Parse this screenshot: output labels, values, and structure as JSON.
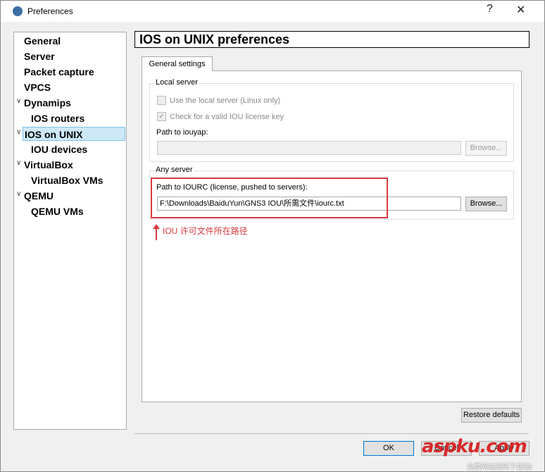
{
  "window": {
    "title": "Preferences",
    "help": "?",
    "close": "✕"
  },
  "sidebar": {
    "items": [
      {
        "label": "General",
        "level": 0
      },
      {
        "label": "Server",
        "level": 0
      },
      {
        "label": "Packet capture",
        "level": 0
      },
      {
        "label": "VPCS",
        "level": 0
      },
      {
        "label": "Dynamips",
        "level": 0,
        "expanded": true
      },
      {
        "label": "IOS routers",
        "level": 1
      },
      {
        "label": "IOS on UNIX",
        "level": 0,
        "expanded": true,
        "selected": true
      },
      {
        "label": "IOU devices",
        "level": 1
      },
      {
        "label": "VirtualBox",
        "level": 0,
        "expanded": true
      },
      {
        "label": "VirtualBox VMs",
        "level": 1
      },
      {
        "label": "QEMU",
        "level": 0,
        "expanded": true
      },
      {
        "label": "QEMU VMs",
        "level": 1
      }
    ]
  },
  "header": {
    "title": "IOS on UNIX preferences"
  },
  "tabs": [
    {
      "label": "General settings"
    }
  ],
  "local_server": {
    "title": "Local server",
    "use_local": "Use the local server (Linux only)",
    "use_local_checked": false,
    "check_license": "Check for a valid IOU license key",
    "check_license_checked": true,
    "iouyap_label": "Path to iouyap:",
    "iouyap_value": "",
    "browse": "Browse..."
  },
  "any_server": {
    "title": "Any server",
    "iourc_label": "Path to IOURC (license, pushed to servers):",
    "iourc_value": "F:\\Downloads\\BaiduYun\\GNS3 IOU\\所需文件\\iourc.txt",
    "browse": "Browse..."
  },
  "annotation": "IOU 许可文件所在路径",
  "buttons": {
    "restore": "Restore defaults",
    "ok": "OK",
    "cancel": "Cancel",
    "apply": "Apply"
  },
  "watermark": {
    "main": "aspku.com",
    "sub": "免费网站源码下载站!"
  }
}
